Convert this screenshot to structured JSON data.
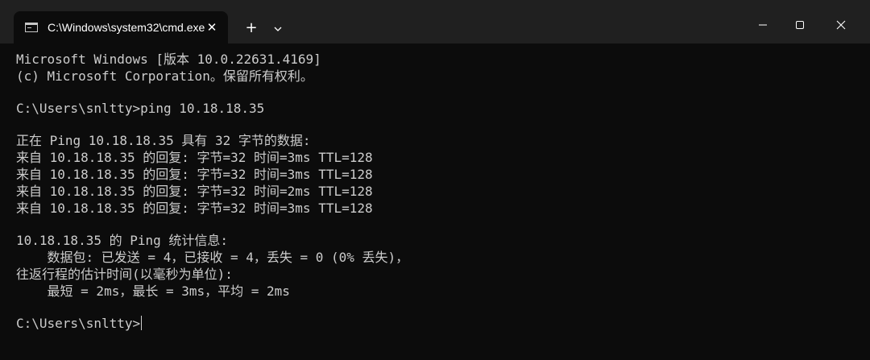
{
  "window": {
    "tab_title": "C:\\Windows\\system32\\cmd.exe",
    "tab_close_glyph": "✕",
    "new_tab_glyph": "+",
    "colors": {
      "titlebar": "#202020",
      "terminal_bg": "#0c0c0c",
      "text": "#cccccc"
    }
  },
  "terminal": {
    "lines": [
      "Microsoft Windows [版本 10.0.22631.4169]",
      "(c) Microsoft Corporation。保留所有权利。",
      "",
      "C:\\Users\\snltty>ping 10.18.18.35",
      "",
      "正在 Ping 10.18.18.35 具有 32 字节的数据:",
      "来自 10.18.18.35 的回复: 字节=32 时间=3ms TTL=128",
      "来自 10.18.18.35 的回复: 字节=32 时间=3ms TTL=128",
      "来自 10.18.18.35 的回复: 字节=32 时间=2ms TTL=128",
      "来自 10.18.18.35 的回复: 字节=32 时间=3ms TTL=128",
      "",
      "10.18.18.35 的 Ping 统计信息:",
      "    数据包: 已发送 = 4，已接收 = 4，丢失 = 0 (0% 丢失)，",
      "往返行程的估计时间(以毫秒为单位):",
      "    最短 = 2ms，最长 = 3ms，平均 = 2ms",
      "",
      "C:\\Users\\snltty>"
    ]
  }
}
